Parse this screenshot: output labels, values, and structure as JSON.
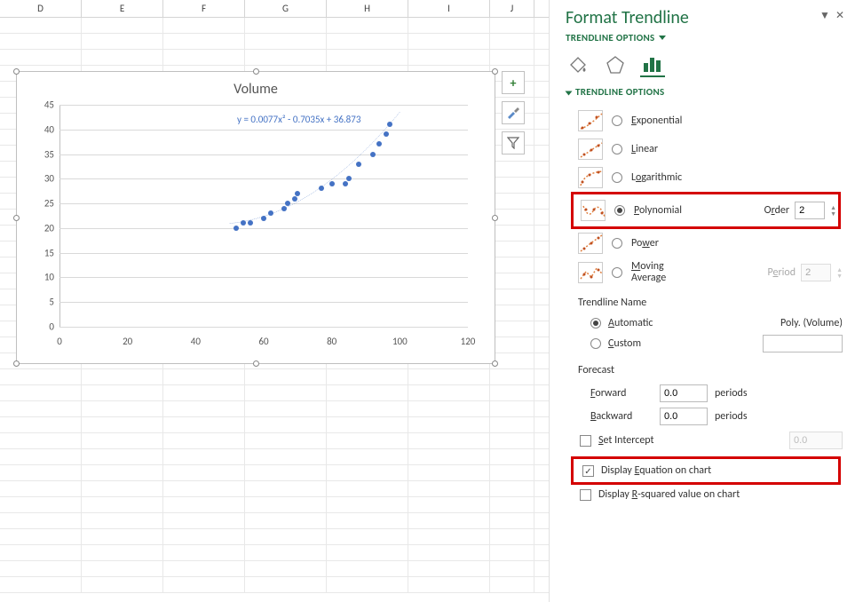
{
  "columns": [
    "D",
    "E",
    "F",
    "G",
    "H",
    "I",
    "J"
  ],
  "chart": {
    "title": "Volume",
    "equation": "y = 0.0077x² - 0.7035x + 36.873",
    "y_ticks": [
      0,
      5,
      10,
      15,
      20,
      25,
      30,
      35,
      40,
      45
    ],
    "x_ticks": [
      0,
      20,
      40,
      60,
      80,
      100,
      120
    ]
  },
  "chart_data": {
    "type": "scatter",
    "x": [
      52,
      54,
      56,
      60,
      62,
      66,
      67,
      69,
      70,
      77,
      80,
      84,
      85,
      88,
      92,
      94,
      96,
      97
    ],
    "y": [
      20,
      21,
      21,
      22,
      23,
      24,
      25,
      26,
      27,
      28,
      29,
      29,
      30,
      33,
      35,
      37,
      39,
      41
    ],
    "title": "Volume",
    "xlim": [
      0,
      120
    ],
    "ylim": [
      0,
      45
    ],
    "trendline": {
      "type": "polynomial",
      "order": 2,
      "equation": "y = 0.0077x^2 - 0.7035x + 36.873"
    }
  },
  "tools": {
    "plus": "+",
    "brush": "brush",
    "funnel": "filter"
  },
  "panel": {
    "title": "Format Trendline",
    "dropdown": "TRENDLINE OPTIONS",
    "section": "TRENDLINE OPTIONS",
    "options": {
      "exponential": "Exponential",
      "linear": "Linear",
      "logarithmic": "Logarithmic",
      "polynomial": "Polynomial",
      "power": "Power",
      "moving_avg": "Moving Average",
      "order_label": "Order",
      "order_value": "2",
      "period_label": "Period",
      "period_value": "2"
    },
    "trendline_name": {
      "header": "Trendline Name",
      "automatic": "Automatic",
      "custom": "Custom",
      "auto_value": "Poly. (Volume)"
    },
    "forecast": {
      "header": "Forecast",
      "forward": "Forward",
      "backward": "Backward",
      "fw_value": "0.0",
      "bw_value": "0.0",
      "unit": "periods"
    },
    "set_intercept": {
      "label": "Set Intercept",
      "value": "0.0"
    },
    "display_eq": "Display Equation on chart",
    "display_r2": "Display R-squared value on chart"
  }
}
